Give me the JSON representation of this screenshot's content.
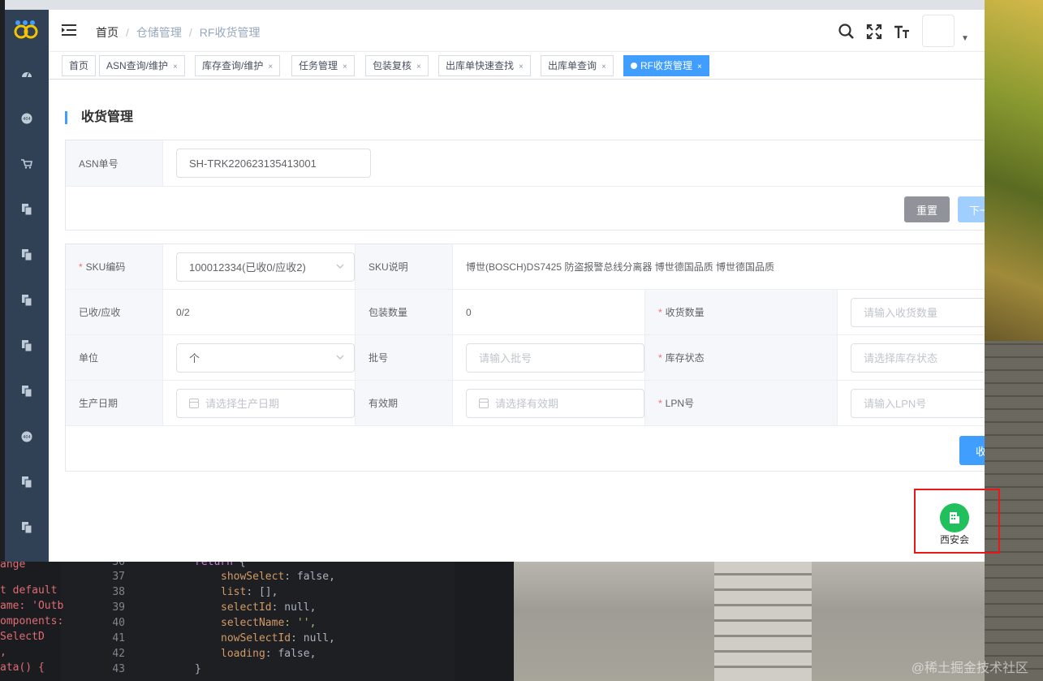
{
  "header": {
    "breadcrumb": [
      "首页",
      "仓储管理",
      "RF收货管理"
    ]
  },
  "tags": [
    {
      "label": "首页",
      "closable": false
    },
    {
      "label": "ASN查询/维护",
      "closable": true
    },
    {
      "label": "库存查询/维护",
      "closable": true
    },
    {
      "label": "任务管理",
      "closable": true
    },
    {
      "label": "包装复核",
      "closable": true
    },
    {
      "label": "出库单快速查找",
      "closable": true
    },
    {
      "label": "出库单查询",
      "closable": true
    },
    {
      "label": "RF收货管理",
      "closable": true,
      "active": true
    }
  ],
  "page": {
    "title": "收货管理",
    "asn": {
      "label": "ASN单号",
      "value": "SH-TRK220623135413001",
      "reset_label": "重置",
      "next_label": "下一"
    },
    "form": {
      "sku_label": "SKU编码",
      "sku_value": "100012334(已收0/应收2)",
      "sku_desc_label": "SKU说明",
      "sku_desc_value": "博世(BOSCH)DS7425 防盗报警总线分离器 博世德国品质 博世德国品质",
      "received_label": "已收/应收",
      "received_value": "0/2",
      "pack_qty_label": "包装数量",
      "pack_qty_value": "0",
      "recv_qty_label": "收货数量",
      "recv_qty_placeholder": "请输入收货数量",
      "unit_label": "单位",
      "unit_value": "个",
      "batch_label": "批号",
      "batch_placeholder": "请输入批号",
      "stock_status_label": "库存状态",
      "stock_status_placeholder": "请选择库存状态",
      "mfg_date_label": "生产日期",
      "mfg_date_placeholder": "请选择生产日期",
      "expiry_label": "有效期",
      "expiry_placeholder": "请选择有效期",
      "lpn_label": "LPN号",
      "lpn_placeholder": "请输入LPN号",
      "submit_label": "收"
    }
  },
  "floating": {
    "label": "西安会"
  },
  "editor": {
    "left_lines": [
      "ange",
      "t default",
      "ame: 'Outb",
      "omponents:",
      "  SelectD",
      ",",
      "ata() {"
    ],
    "line_numbers": [
      "36",
      "37",
      "38",
      "39",
      "40",
      "41",
      "42",
      "43"
    ],
    "code": [
      {
        "key": "return",
        "rest": " {"
      },
      {
        "key": "showSelect",
        "rest": ": false,"
      },
      {
        "key": "list",
        "rest": ": [],"
      },
      {
        "key": "selectId",
        "rest": ": null,"
      },
      {
        "key": "selectName",
        "rest": ": '',"
      },
      {
        "key": "nowSelectId",
        "rest": ": null,"
      },
      {
        "key": "loading",
        "rest": ": false,"
      },
      {
        "key": "}",
        "rest": ""
      }
    ]
  },
  "watermark": "@稀土掘金技术社区",
  "colors": {
    "sidebar": "#304156",
    "accent": "#409eff",
    "required": "#f56c6c",
    "float_icon": "#20c05c",
    "highlight_box": "#e81818"
  }
}
